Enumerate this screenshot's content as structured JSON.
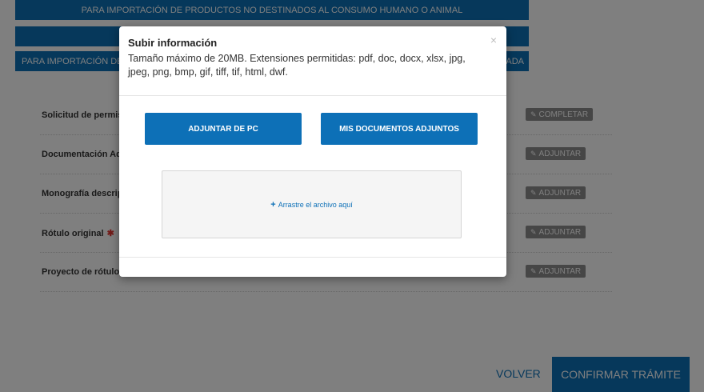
{
  "tabs": [
    {
      "label": "PARA IMPORTACIÓN DE PRODUCTOS NO DESTINADOS AL CONSUMO HUMANO O ANIMAL"
    },
    {
      "label": "PA"
    },
    {
      "label": "PARA IMPORTACIÓN DE",
      "trailing": "ADA"
    }
  ],
  "documents": [
    {
      "label": "Solicitud de permis",
      "required": false,
      "action": "COMPLETAR",
      "action_icon": "pencil-icon"
    },
    {
      "label": "Documentación Adi",
      "required": false,
      "action": "ADJUNTAR",
      "action_icon": "paperclip-icon"
    },
    {
      "label": "Monografía descrip",
      "required": false,
      "action": "ADJUNTAR",
      "action_icon": "paperclip-icon"
    },
    {
      "label": "Rótulo original",
      "required": true,
      "required_mark": "✱",
      "action": "ADJUNTAR",
      "action_icon": "paperclip-icon"
    },
    {
      "label": "Proyecto de rótulo",
      "required": false,
      "action": "ADJUNTAR",
      "action_icon": "paperclip-icon"
    }
  ],
  "footer": {
    "back_label": "VOLVER",
    "confirm_label": "CONFIRMAR TRÁMITE"
  },
  "modal": {
    "title": "Subir información",
    "description": "Tamaño máximo de 20MB. Extensiones permitidas: pdf, doc, docx, xlsx, jpg, jpeg, png, bmp, gif, tiff, tif, html, dwf.",
    "close_label": "×",
    "upload_pc_label": "ADJUNTAR DE PC",
    "my_docs_label": "MIS DOCUMENTOS ADJUNTOS",
    "dropzone_label": "Arrastre el archivo aquí",
    "dropzone_icon": "plus-icon"
  },
  "colors": {
    "primary": "#0d70b7",
    "action_badge": "#8c8c8c",
    "required": "#e53935"
  }
}
